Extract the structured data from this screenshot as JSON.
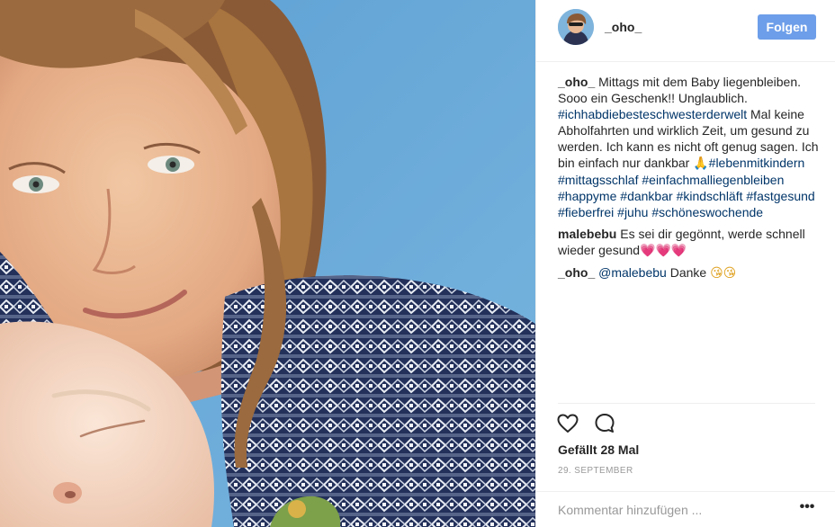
{
  "post": {
    "photo_alt": "",
    "author": "_oho_",
    "follow_label": "Folgen",
    "likes_label": "Gefällt 28 Mal",
    "date_label": "29. SEPTEMBER",
    "comment_placeholder": "Kommentar hinzufügen ...",
    "more_label": "•••"
  },
  "caption": {
    "user": "_oho_",
    "text_1": "Mittags mit dem Baby liegenbleiben. Sooo ein Geschenk!! Unglaublich.",
    "tag_1": "#ichhabdiebesteschwesterderwelt",
    "text_2": "Mal keine Abholfahrten und wirklich Zeit, um gesund zu werden. Ich kann es nicht oft genug sagen. Ich bin einfach nur dankbar",
    "emoji_pray": "🙏",
    "tag_2": "#lebenmitkindern",
    "tag_3": "#mittagsschlaf",
    "tag_4": "#einfachmalliegenbleiben",
    "tag_5": "#happyme",
    "tag_6": "#dankbar",
    "tag_7": "#kindschläft",
    "tag_8": "#fastgesund",
    "tag_9": "#fieberfrei",
    "tag_10": "#juhu",
    "tag_11": "#schöneswochende"
  },
  "comments": [
    {
      "user": "malebebu",
      "text": "Es sei dir gegönnt, werde schnell wieder gesund",
      "emoji": "💗💗💗"
    },
    {
      "user": "_oho_",
      "mention": "@malebebu",
      "text": "Danke",
      "emoji": "😘😘"
    }
  ],
  "icons": {
    "like": "heart-icon",
    "comment": "comment-bubble-icon",
    "more": "more-options-icon"
  },
  "colors": {
    "follow_button": "#6d9ee9",
    "hashtag": "#003569",
    "text": "#262626",
    "muted": "#999999",
    "photo_background": "#6aa9d6"
  }
}
